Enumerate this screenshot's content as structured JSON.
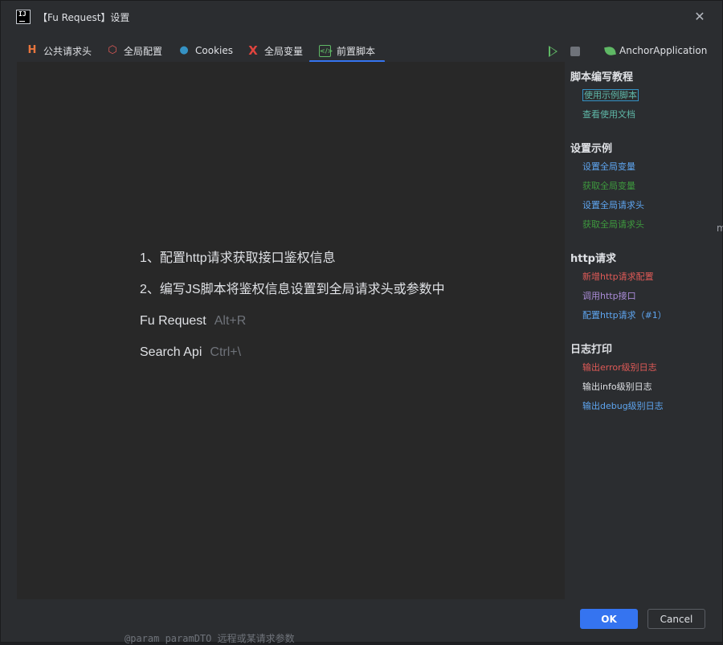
{
  "window": {
    "title": "【Fu Request】设置"
  },
  "tabs": [
    {
      "label": "公共请求头",
      "icon": "H",
      "icon_name": "h-letter-icon",
      "color": "#e8753d"
    },
    {
      "label": "全局配置",
      "icon": "⬡",
      "icon_name": "gear-hex-icon",
      "color": "#e05a57"
    },
    {
      "label": "Cookies",
      "icon": "●",
      "icon_name": "cookie-icon",
      "color": "#3592c4"
    },
    {
      "label": "全局变量",
      "icon": "X",
      "icon_name": "x-variable-icon",
      "color": "#e0443e"
    },
    {
      "label": "前置脚本",
      "icon": "</>",
      "icon_name": "code-icon",
      "color": "#5fb865"
    }
  ],
  "toolbar": {
    "run_icon": "play-icon",
    "stop_icon": "stop-icon",
    "profile_label": "AnchorApplication"
  },
  "editor": {
    "hints": [
      {
        "text": "1、配置http请求获取接口鉴权信息",
        "shortcut": ""
      },
      {
        "text": "2、编写JS脚本将鉴权信息设置到全局请求头或参数中",
        "shortcut": ""
      },
      {
        "text": "Fu Request",
        "shortcut": "Alt+R"
      },
      {
        "text": "Search Api",
        "shortcut": "Ctrl+\\"
      }
    ]
  },
  "sidebar": {
    "sections": [
      {
        "title": "脚本编写教程",
        "links": [
          {
            "label": "使用示例脚本",
            "color": "#5fb8a8"
          },
          {
            "label": "查看使用文档",
            "color": "#5fb8a8"
          }
        ]
      },
      {
        "title": "设置示例",
        "links": [
          {
            "label": "设置全局变量",
            "color": "#5ea5f0"
          },
          {
            "label": "获取全局变量",
            "color": "#3e9a3e"
          },
          {
            "label": "设置全局请求头",
            "color": "#5ea5f0"
          },
          {
            "label": "获取全局请求头",
            "color": "#3e9a3e"
          }
        ]
      },
      {
        "title": "http请求",
        "links": [
          {
            "label": "新增http请求配置",
            "color": "#e05a57"
          },
          {
            "label": "调用http接口",
            "color": "#a98bd6"
          },
          {
            "label": "配置http请求（#1）",
            "color": "#5ea5f0"
          }
        ]
      },
      {
        "title": "日志打印",
        "links": [
          {
            "label": "输出error级别日志",
            "color": "#e05a57"
          },
          {
            "label": "输出info级别日志",
            "color": "#dfe1e5"
          },
          {
            "label": "输出debug级别日志",
            "color": "#5ea5f0"
          }
        ]
      }
    ]
  },
  "buttons": {
    "ok": "OK",
    "cancel": "Cancel"
  },
  "background": {
    "edge_char": "m",
    "code_line": "@param paramDTO 远程或某请求参数"
  }
}
